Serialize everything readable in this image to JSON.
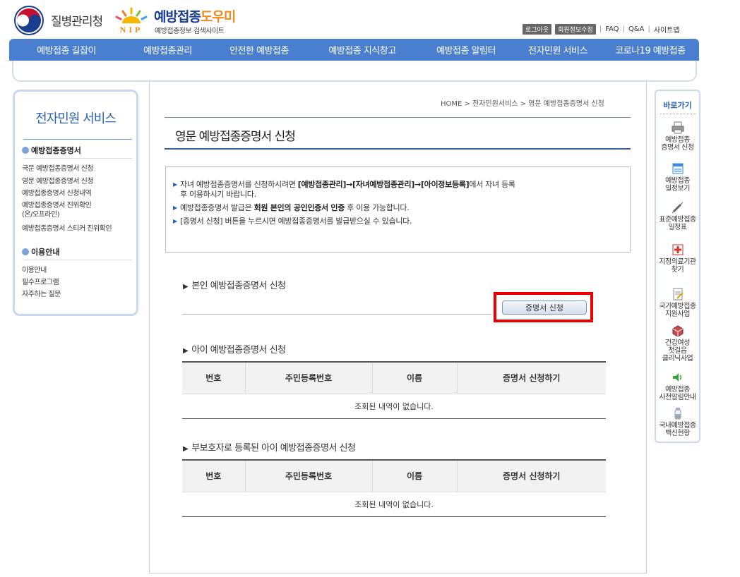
{
  "header": {
    "kdca_name": "질병관리청",
    "nip_badge": "NIP",
    "nip_title_main": "예방접종",
    "nip_title_accent": "도우미",
    "nip_subtitle": "예방접종정보 검색사이트",
    "util": {
      "logout": "로그아웃",
      "member_edit": "회원정보수정",
      "faq": "FAQ",
      "qa": "Q&A",
      "sitemap": "사이트맵"
    }
  },
  "gnb": {
    "items": [
      {
        "label": "예방접종 길잡이"
      },
      {
        "label": "예방접종관리"
      },
      {
        "label": "안전한 예방접종"
      },
      {
        "label": "예방접종 지식창고"
      },
      {
        "label": "예방접종 알림터"
      },
      {
        "label": "전자민원 서비스"
      },
      {
        "label": "코로나19 예방접종"
      }
    ]
  },
  "lnb": {
    "title": "전자민원 서비스",
    "section1": {
      "label": "예방접종증명서",
      "links": [
        "국문 예방접종증명서 신청",
        "영문 예방접종증명서 신청",
        "예방접종증명서 신청내역",
        "예방접종증명서 진위확인\n(온/오프라인)",
        "예방접종증명서 스티커 진위확인"
      ]
    },
    "section2": {
      "label": "이용안내",
      "links": [
        "이용안내",
        "필수프로그램",
        "자주하는 질문"
      ]
    }
  },
  "main": {
    "breadcrumb": "HOME > 전자민원서비스 > 영문 예방접종증명서 신청",
    "page_title": "영문 예방접종증명서 신청",
    "notice": {
      "line1a": "자녀 예방접종증명서를 신청하시려면 ",
      "line1b": "[예방접종관리]→[자녀예방접종관리]→[아이정보등록]",
      "line1c": "에서 자녀 등록",
      "line1d": "후 이용하시기 바랍니다.",
      "line2a": "예방접종증명서 발급은 ",
      "line2b": "회원 본인의 공인인증서 인증",
      "line2c": " 후 이용 가능합니다.",
      "line3": "[증명서 신청] 버튼을 누르시면 예방접종증명서를 발급받으실 수 있습니다."
    },
    "self_section": {
      "title": "본인 예방접종증명서 신청",
      "button": "증명서 신청"
    },
    "child_section": {
      "title": "아이 예방접종증명서 신청",
      "headers": [
        "번호",
        "주민등록번호",
        "이름",
        "증명서 신청하기"
      ],
      "empty": "조회된 내역이 없습니다."
    },
    "guardian_section": {
      "title": "부보호자로 등록된 아이 예방접종증명서 신청",
      "headers": [
        "번호",
        "주민등록번호",
        "이름",
        "증명서 신청하기"
      ],
      "empty": "조회된 내역이 없습니다."
    }
  },
  "quick": {
    "title": "바로가기",
    "items": [
      {
        "label": "예방접종\n증명서 신청",
        "icon": "printer-icon"
      },
      {
        "label": "예방접종\n일정보기",
        "icon": "calendar-icon"
      },
      {
        "label": "표준예방접종\n일정표",
        "icon": "syringe-icon"
      },
      {
        "label": "지정의료기관\n찾기",
        "icon": "hospital-icon"
      },
      {
        "label": "국가예방접종\n지원사업",
        "icon": "document-icon"
      },
      {
        "label": "건강여성\n첫걸음\n클리닉사업",
        "icon": "box-icon"
      },
      {
        "label": "예방접종\n사전알림안내",
        "icon": "speaker-icon"
      },
      {
        "label": "국내예방접종\n백신현황",
        "icon": "vial-icon"
      }
    ]
  },
  "colors": {
    "gnb": "#4a7fd0",
    "lnb_title": "#2a62b5",
    "highlight": "#ee0000"
  }
}
